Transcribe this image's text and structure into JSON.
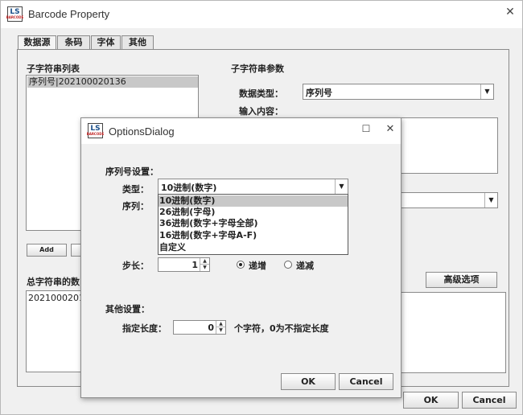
{
  "main": {
    "title": "Barcode Property",
    "logo": {
      "main": "LS",
      "sub": "BARCODE"
    },
    "close_glyph": "✕",
    "tabs": [
      "数据源",
      "条码",
      "字体",
      "其他"
    ],
    "substring_list_label": "子字符串列表",
    "substring_items": [
      "序列号|202100020136"
    ],
    "add_button": "Add",
    "total_label": "总字符串的数",
    "total_value": "2021000201",
    "params_label": "子字符串参数",
    "data_type_label": "数据类型：",
    "data_type_value": "序列号",
    "input_content_label": "输入内容：",
    "advanced_button": "高级选项",
    "ok_button": "OK",
    "cancel_button": "Cancel"
  },
  "dialog": {
    "title": "OptionsDialog",
    "logo": {
      "main": "LS",
      "sub": "BARCODE"
    },
    "maximize_glyph": "☐",
    "close_glyph": "✕",
    "serial_settings_label": "序列号设置：",
    "type_label": "类型：",
    "type_value": "10进制(数字)",
    "sequence_label": "序列：",
    "type_options": [
      "10进制(数字)",
      "26进制(字母)",
      "36进制(数字+字母全部)",
      "16进制(数字+字母A-F)",
      "自定义"
    ],
    "selected_option_index": 0,
    "step_label": "步长：",
    "step_value": "1",
    "increment_label": "递增",
    "decrement_label": "递减",
    "direction": "increment",
    "other_settings_label": "其他设置：",
    "length_label": "指定长度：",
    "length_value": "0",
    "length_hint": "个字符，0为不指定长度",
    "ok_button": "OK",
    "cancel_button": "Cancel"
  },
  "colors": {
    "selection": "#c8c8c8",
    "window_bg": "#f0f0f0",
    "titlebar_bg": "#ffffff"
  }
}
